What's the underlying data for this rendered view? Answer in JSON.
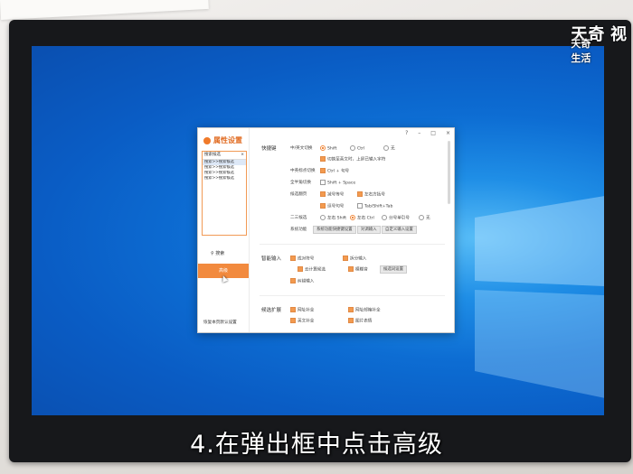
{
  "brand": {
    "name": "天奇",
    "sub": "天奇生活",
    "tail": "视"
  },
  "subtitle": "4.在弹出框中点击高级",
  "dialog": {
    "title": "属性设置",
    "controls": [
      "?",
      "–",
      "□",
      "×"
    ],
    "search_box": {
      "header": "搜索候选",
      "items": [
        "搜索>>搜索候选",
        "搜索>>搜索候选",
        "搜索>>搜索候选",
        "搜索>>搜索候选"
      ]
    },
    "search_label": "搜索",
    "advanced_label": "高级",
    "restore_label": "恢复本页默认设置",
    "shortcuts": {
      "title": "快捷键",
      "cn_en_label": "中/英文切换",
      "opt_shift": "Shift",
      "opt_ctrl": "Ctrl",
      "opt_none": "无",
      "switch_note": "切换至英文时，上屏已输入字符",
      "simp_trad_label": "中英标点切换",
      "ctrl_dot": "Ctrl + 句号",
      "full_half_label": "全半角切换",
      "shift_space": "Shift + Space",
      "page_label": "候选翻页",
      "minus_equal": "减号等号",
      "brackets": "左右方括号",
      "comma_period": "逗号句号",
      "tab_shift": "Tab/Shift+Tab",
      "second_third_label": "二三候选",
      "lr_shift": "左右 Shift",
      "lr_ctrl": "左右 Ctrl",
      "semicolon_quote": "分号单引号",
      "none": "无",
      "system_label": "系统功能",
      "sys_btn1": "系统功能快捷键设置",
      "sys_btn2": "对调输入",
      "sys_btn3": "自定义输入设置"
    },
    "assist": {
      "title": "智能输入",
      "smart_bracket": "成对符号",
      "fuzzy": "模糊音",
      "fuzzy_input": "拆分输入",
      "cloud": "云计算候选",
      "cloud_btn": "候选词设置",
      "auto_correct": "纠错输入",
      "auto_btn": "拼音纠错设置"
    },
    "expand": {
      "title": "候选扩展",
      "word_expand": "网址补全",
      "hint": "网址邮箱补全",
      "more": "英文补全",
      "pic": "图片表情"
    }
  }
}
